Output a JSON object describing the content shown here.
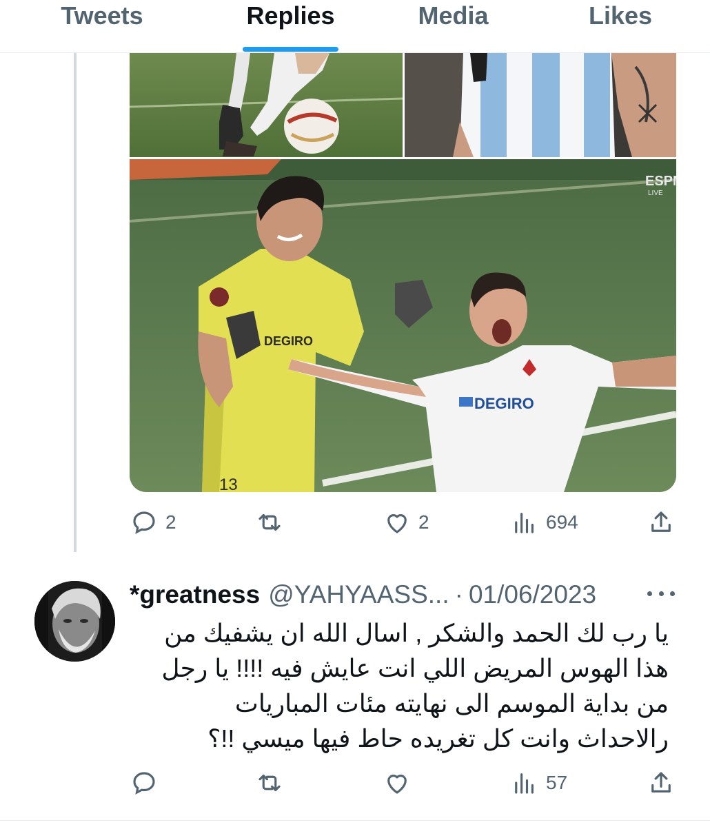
{
  "tabs": [
    {
      "label": "Tweets",
      "active": false
    },
    {
      "label": "Replies",
      "active": true
    },
    {
      "label": "Media",
      "active": false
    },
    {
      "label": "Likes",
      "active": false
    }
  ],
  "accent_color": "#1d9bf0",
  "tweet": {
    "media": [
      {
        "description": "football-kick-closeup"
      },
      {
        "description": "argentina-jersey-number-4"
      },
      {
        "description": "sevilla-goalkeeper-celebration",
        "overlay_text": "ESPN",
        "jersey_sponsor": "DEGIRO",
        "shirt_number": "13"
      }
    ],
    "actions": {
      "replies": "2",
      "retweets": "",
      "likes": "2",
      "views": "694"
    }
  },
  "reply": {
    "name": "*greatness",
    "handle": "@YAHYAASS...",
    "separator": "·",
    "date": "01/06/2023",
    "text_lines": [
      "يا رب لك الحمد والشكر , اسال الله ان يشفيك من",
      "هذا الهوس المريض اللي انت عايش فيه !!!! يا رجل",
      "من بداية الموسم الى نهايته مئات المباريات",
      "رالاحداث وانت كل تغريده حاط فيها ميسي !!؟"
    ],
    "actions": {
      "replies": "",
      "retweets": "",
      "likes": "",
      "views": "57"
    }
  }
}
